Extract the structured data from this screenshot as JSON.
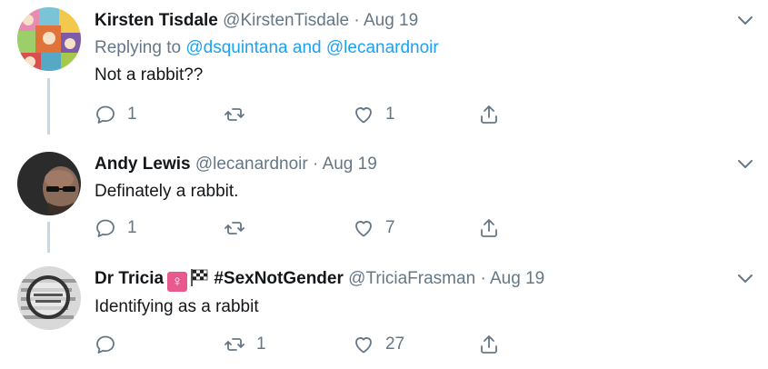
{
  "tweets": [
    {
      "name": "Kirsten Tisdale",
      "handle": "@KirstenTisdale",
      "separator": "·",
      "date": "Aug 19",
      "replying_prefix": "Replying to",
      "replying_user1": "@dsquintana",
      "replying_and": "and",
      "replying_user2": "@lecanardnoir",
      "text": "Not a rabbit??",
      "replies": "1",
      "retweets": "",
      "likes": "1"
    },
    {
      "name": "Andy Lewis",
      "handle": "@lecanardnoir",
      "separator": "·",
      "date": "Aug 19",
      "text": "Definately a rabbit.",
      "replies": "1",
      "retweets": "",
      "likes": "7"
    },
    {
      "name": "Dr Tricia",
      "hashtag": "#SexNotGender",
      "handle": "@TriciaFrasman",
      "separator": "·",
      "date": "Aug 19",
      "text": "Identifying as a rabbit",
      "replies": "",
      "retweets": "1",
      "likes": "27"
    }
  ],
  "icons": {
    "reply": "reply-icon",
    "retweet": "retweet-icon",
    "like": "heart-icon",
    "share": "share-icon",
    "caret": "chevron-down-icon",
    "female_sign": "♀",
    "flag": "checkered-flag-icon"
  },
  "colors": {
    "link": "#1da1f2",
    "meta": "#657786",
    "thread_line": "#ccd6dd"
  }
}
